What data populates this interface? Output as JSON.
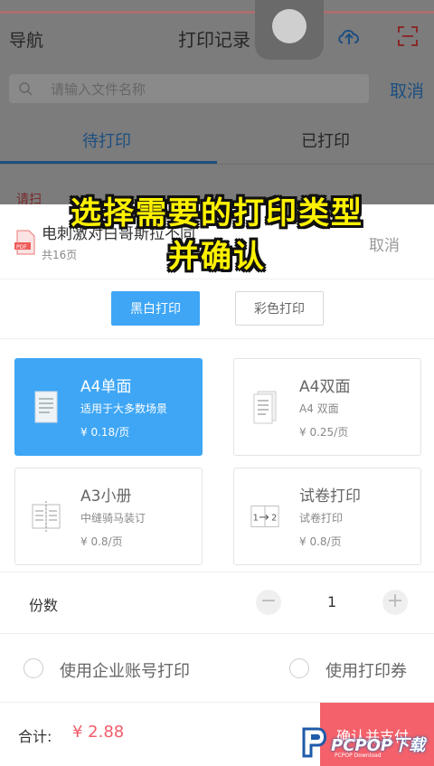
{
  "background": {
    "nav_label": "导航",
    "title": "打印记录",
    "search_placeholder": "请输入文件名称",
    "search_cancel": "取消",
    "tabs": [
      {
        "label": "待打印"
      },
      {
        "label": "已打印"
      }
    ],
    "partial_hint": "请扫"
  },
  "sheet": {
    "file_name": "电刺激对白哥斯拉不同",
    "file_pages": "共16页",
    "file_badge": "PDF",
    "cancel": "取消",
    "modes": [
      {
        "label": "黑白打印",
        "selected": true
      },
      {
        "label": "彩色打印",
        "selected": false
      }
    ],
    "cards": [
      {
        "title": "A4单面",
        "desc": "适用于大多数场景",
        "price": "¥ 0.18/页",
        "icon": "single-page-icon",
        "selected": true
      },
      {
        "title": "A4双面",
        "desc": "A4 双面",
        "price": "¥ 0.25/页",
        "icon": "double-page-icon",
        "selected": false
      },
      {
        "title": "A3小册",
        "desc": "中缝骑马装订",
        "price": "¥ 0.8/页",
        "icon": "booklet-icon",
        "selected": false
      },
      {
        "title": "试卷打印",
        "desc": "试卷打印",
        "price": "¥ 0.8/页",
        "icon": "exam-paper-icon",
        "selected": false
      }
    ],
    "copies_label": "份数",
    "copies_minus": "−",
    "copies_value": "1",
    "copies_plus": "+",
    "options": [
      {
        "label": "使用企业账号打印"
      },
      {
        "label": "使用打印券"
      }
    ],
    "total_label": "合计:",
    "total_amount": "¥ 2.88",
    "pay_label": "确认并支付"
  },
  "caption": {
    "line1": "选择需要的打印类型",
    "line2": "并确认"
  },
  "watermark": {
    "brand": "PCPOP下载",
    "sub": "PCPOP Download"
  },
  "colors": {
    "accent": "#3ea6f5",
    "price": "#f25c6a",
    "pay": "#f4616a",
    "caption": "#fff200"
  }
}
